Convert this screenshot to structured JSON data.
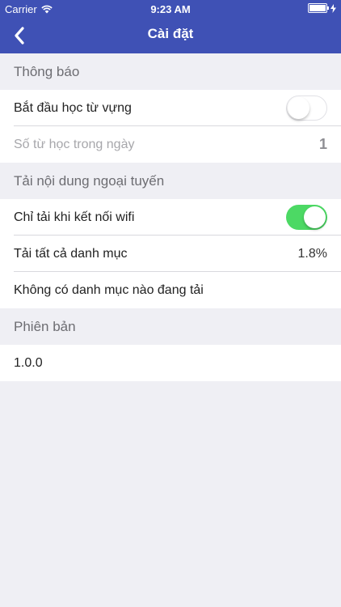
{
  "status_bar": {
    "carrier": "Carrier",
    "time": "9:23 AM"
  },
  "nav": {
    "title": "Cài đặt",
    "back_icon": "chevron-left-icon"
  },
  "sections": {
    "notifications": {
      "header": "Thông báo",
      "start_learning_label": "Bắt đầu học từ vựng",
      "start_learning_enabled": false,
      "words_per_day_label": "Số từ học trong ngày",
      "words_per_day_value": "1"
    },
    "offline": {
      "header": "Tải nội dung ngoại tuyến",
      "wifi_only_label": "Chỉ tải khi kết nối wifi",
      "wifi_only_enabled": true,
      "download_all_label": "Tải tất cả danh mục",
      "download_all_value": "1.8%",
      "no_downloads_label": "Không có danh mục nào đang tải"
    },
    "version": {
      "header": "Phiên bản",
      "value": "1.0.0"
    }
  },
  "colors": {
    "header_bg": "#3f51b5",
    "page_bg": "#efeff4",
    "toggle_on": "#4cd964"
  }
}
